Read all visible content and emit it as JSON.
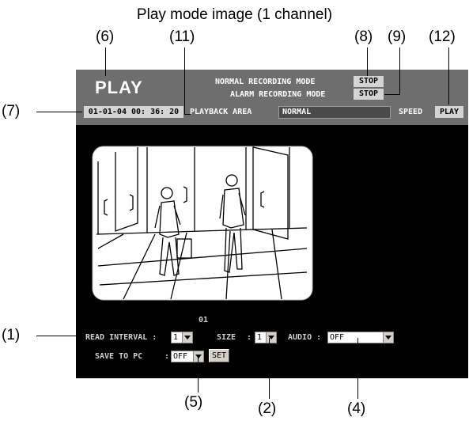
{
  "caption": "Play mode image (1 channel)",
  "callouts": {
    "c1": "(1)",
    "c2": "(2)",
    "c4": "(4)",
    "c5": "(5)",
    "c6": "(6)",
    "c7": "(7)",
    "c8": "(8)",
    "c9": "(9)",
    "c11": "(11)",
    "c12": "(12)"
  },
  "header": {
    "title": "PLAY",
    "normal_mode_label": "NORMAL RECORDING MODE",
    "normal_mode_value": "STOP",
    "alarm_mode_label": "ALARM RECORDING MODE",
    "alarm_mode_value": "STOP",
    "datetime": "01-01-04 00: 36: 20",
    "playback_area_label": "PLAYBACK AREA",
    "playback_area_value": "NORMAL",
    "speed_label": "SPEED",
    "speed_value": "PLAY"
  },
  "viewer": {
    "channel": "01",
    "image_icon": "camera-scene-two-men-corridor"
  },
  "controls": {
    "read_interval_label": "READ INTERVAL :",
    "read_interval_value": "1",
    "size_label": "SIZE",
    "size_colon": ":",
    "size_value": "1",
    "audio_label": "AUDIO :",
    "audio_value": "OFF",
    "save_label": "SAVE TO PC",
    "save_colon": ":",
    "save_value": "OFF",
    "set_button": "SET"
  },
  "colors": {
    "topbar": "#6e6e6e",
    "screen": "#000000"
  }
}
